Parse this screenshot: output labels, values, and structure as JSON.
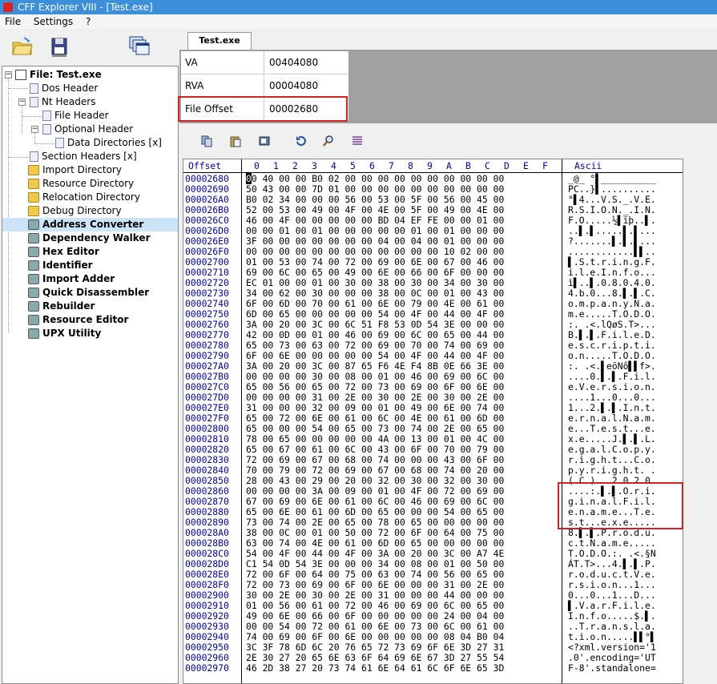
{
  "window": {
    "title": "CFF Explorer VIII - [Test.exe]"
  },
  "menu": {
    "items": [
      "File",
      "Settings",
      "?"
    ]
  },
  "tree": {
    "root": "File: Test.exe",
    "items": [
      {
        "label": "Dos Header"
      },
      {
        "label": "Nt Headers"
      },
      {
        "label": "File Header"
      },
      {
        "label": "Optional Header"
      },
      {
        "label": "Data Directories [x]"
      },
      {
        "label": "Section Headers [x]"
      },
      {
        "label": "Import Directory"
      },
      {
        "label": "Resource Directory"
      },
      {
        "label": "Relocation Directory"
      },
      {
        "label": "Debug Directory"
      },
      {
        "label": "Address Converter"
      },
      {
        "label": "Dependency Walker"
      },
      {
        "label": "Hex Editor"
      },
      {
        "label": "Identifier"
      },
      {
        "label": "Import Adder"
      },
      {
        "label": "Quick Disassembler"
      },
      {
        "label": "Rebuilder"
      },
      {
        "label": "Resource Editor"
      },
      {
        "label": "UPX Utility"
      }
    ],
    "selected": "Address Converter"
  },
  "tab": {
    "label": "Test.exe"
  },
  "converter": {
    "va_label": "VA",
    "va_value": "00404080",
    "rva_label": "RVA",
    "rva_value": "00004080",
    "fo_label": "File Offset",
    "fo_value": "00002680"
  },
  "hex": {
    "offset_header": "Offset",
    "columns": [
      "0",
      "1",
      "2",
      "3",
      "4",
      "5",
      "6",
      "7",
      "8",
      "9",
      "A",
      "B",
      "C",
      "D",
      "E",
      "F"
    ],
    "ascii_header": "Ascii",
    "rows": [
      {
        "off": "00002680",
        "bytes": "00 40 00 00 B0 02 00 00 00 00 00 00 00 00 00 00",
        "asc": "_@_ °▌__________"
      },
      {
        "off": "00002690",
        "bytes": "50 43 00 00 7D 01 00 00 00 00 00 00 00 00 00 00",
        "asc": "PC..}▌.........."
      },
      {
        "off": "000026A0",
        "bytes": "B0 02 34 00 00 00 56 00 53 00 5F 00 56 00 45 00",
        "asc": "°▌4...V.S._.V.E."
      },
      {
        "off": "000026B0",
        "bytes": "52 00 53 00 49 00 4F 00 4E 00 5F 00 49 00 4E 00",
        "asc": "R.S.I.O.N._.I.N."
      },
      {
        "off": "000026C0",
        "bytes": "46 00 4F 00 00 00 00 00 BD 04 EF FE 00 00 01 00",
        "asc": "F.O.....½▌ïþ..▌."
      },
      {
        "off": "000026D0",
        "bytes": "00 00 01 00 01 00 00 00 00 00 01 00 01 00 00 00",
        "asc": "..▌.▌.....▌.▌..."
      },
      {
        "off": "000026E0",
        "bytes": "3F 00 00 00 00 00 00 00 04 00 04 00 01 00 00 00",
        "asc": "?.......▌.▌.▌..."
      },
      {
        "off": "000026F0",
        "bytes": "00 00 00 00 00 00 00 00 00 00 00 00 10 02 00 00",
        "asc": "............▌▌.."
      },
      {
        "off": "00002700",
        "bytes": "01 00 53 00 74 00 72 00 69 00 6E 00 67 00 46 00",
        "asc": "▌.S.t.r.i.n.g.F."
      },
      {
        "off": "00002710",
        "bytes": "69 00 6C 00 65 00 49 00 6E 00 66 00 6F 00 00 00",
        "asc": "i.l.e.I.n.f.o..."
      },
      {
        "off": "00002720",
        "bytes": "EC 01 00 00 01 00 30 00 38 00 30 00 34 00 30 00",
        "asc": "ì▌..▌.0.8.0.4.0."
      },
      {
        "off": "00002730",
        "bytes": "34 00 62 00 30 00 00 00 38 00 0C 00 01 00 43 00",
        "asc": "4.b.0...8.▌.▌.C."
      },
      {
        "off": "00002740",
        "bytes": "6F 00 6D 00 70 00 61 00 6E 00 79 00 4E 00 61 00",
        "asc": "o.m.p.a.n.y.N.a."
      },
      {
        "off": "00002750",
        "bytes": "6D 00 65 00 00 00 00 00 54 00 4F 00 44 00 4F 00",
        "asc": "m.e.....T.O.D.O."
      },
      {
        "off": "00002760",
        "bytes": "3A 00 20 00 3C 00 6C 51 F8 53 0D 54 3E 00 00 00",
        "asc": ":. .<.lQøS.T>..."
      },
      {
        "off": "00002770",
        "bytes": "42 00 0D 00 01 00 46 00 69 00 6C 00 65 00 44 00",
        "asc": "B.▌.▌.F.i.l.e.D."
      },
      {
        "off": "00002780",
        "bytes": "65 00 73 00 63 00 72 00 69 00 70 00 74 00 69 00",
        "asc": "e.s.c.r.i.p.t.i."
      },
      {
        "off": "00002790",
        "bytes": "6F 00 6E 00 00 00 00 00 54 00 4F 00 44 00 4F 00",
        "asc": "o.n.....T.O.D.O."
      },
      {
        "off": "000027A0",
        "bytes": "3A 00 20 00 3C 00 87 65 F6 4E F4 8B 0E 66 3E 00",
        "asc": ":. .<.▌eöNô▌▌f>."
      },
      {
        "off": "000027B0",
        "bytes": "00 00 00 00 30 00 08 00 01 00 46 00 69 00 6C 00",
        "asc": "....0.▌.▌.F.i.l."
      },
      {
        "off": "000027C0",
        "bytes": "65 00 56 00 65 00 72 00 73 00 69 00 6F 00 6E 00",
        "asc": "e.V.e.r.s.i.o.n."
      },
      {
        "off": "000027D0",
        "bytes": "00 00 00 00 31 00 2E 00 30 00 2E 00 30 00 2E 00",
        "asc": "....1...0...0..."
      },
      {
        "off": "000027E0",
        "bytes": "31 00 00 00 32 00 09 00 01 00 49 00 6E 00 74 00",
        "asc": "1...2.▌.▌.I.n.t."
      },
      {
        "off": "000027F0",
        "bytes": "65 00 72 00 6E 00 61 00 6C 00 4E 00 61 00 6D 00",
        "asc": "e.r.n.a.l.N.a.m."
      },
      {
        "off": "00002800",
        "bytes": "65 00 00 00 54 00 65 00 73 00 74 00 2E 00 65 00",
        "asc": "e...T.e.s.t...e."
      },
      {
        "off": "00002810",
        "bytes": "78 00 65 00 00 00 00 00 4A 00 13 00 01 00 4C 00",
        "asc": "x.e.....J.▌.▌.L."
      },
      {
        "off": "00002820",
        "bytes": "65 00 67 00 61 00 6C 00 43 00 6F 00 70 00 79 00",
        "asc": "e.g.a.l.C.o.p.y."
      },
      {
        "off": "00002830",
        "bytes": "72 00 69 00 67 00 68 00 74 00 00 00 43 00 6F 00",
        "asc": "r.i.g.h.t...C.o."
      },
      {
        "off": "00002840",
        "bytes": "70 00 79 00 72 00 69 00 67 00 68 00 74 00 20 00",
        "asc": "p.y.r.i.g.h.t. ."
      },
      {
        "off": "00002850",
        "bytes": "28 00 43 00 29 00 20 00 32 00 30 00 32 00 30 00",
        "asc": "(.C.). .2.0.2.0."
      },
      {
        "off": "00002860",
        "bytes": "00 00 00 00 3A 00 09 00 01 00 4F 00 72 00 69 00",
        "asc": "....:.▌.▌.O.r.i."
      },
      {
        "off": "00002870",
        "bytes": "67 00 69 00 6E 00 61 00 6C 00 46 00 69 00 6C 00",
        "asc": "g.i.n.a.l.F.i.l."
      },
      {
        "off": "00002880",
        "bytes": "65 00 6E 00 61 00 6D 00 65 00 00 00 54 00 65 00",
        "asc": "e.n.a.m.e...T.e."
      },
      {
        "off": "00002890",
        "bytes": "73 00 74 00 2E 00 65 00 78 00 65 00 00 00 00 00",
        "asc": "s.t...e.x.e....."
      },
      {
        "off": "000028A0",
        "bytes": "38 00 0C 00 01 00 50 00 72 00 6F 00 64 00 75 00",
        "asc": "8.▌.▌.P.r.o.d.u."
      },
      {
        "off": "000028B0",
        "bytes": "63 00 74 00 4E 00 61 00 6D 00 65 00 00 00 00 00",
        "asc": "c.t.N.a.m.e....."
      },
      {
        "off": "000028C0",
        "bytes": "54 00 4F 00 44 00 4F 00 3A 00 20 00 3C 00 A7 4E",
        "asc": "T.O.D.O.:. .<.§N"
      },
      {
        "off": "000028D0",
        "bytes": "C1 54 0D 54 3E 00 00 00 34 00 08 00 01 00 50 00",
        "asc": "ÁT.T>...4.▌.▌.P."
      },
      {
        "off": "000028E0",
        "bytes": "72 00 6F 00 64 00 75 00 63 00 74 00 56 00 65 00",
        "asc": "r.o.d.u.c.t.V.e."
      },
      {
        "off": "000028F0",
        "bytes": "72 00 73 00 69 00 6F 00 6E 00 00 00 31 00 2E 00",
        "asc": "r.s.i.o.n...1..."
      },
      {
        "off": "00002900",
        "bytes": "30 00 2E 00 30 00 2E 00 31 00 00 00 44 00 00 00",
        "asc": "0...0...1...D..."
      },
      {
        "off": "00002910",
        "bytes": "01 00 56 00 61 00 72 00 46 00 69 00 6C 00 65 00",
        "asc": "▌.V.a.r.F.i.l.e."
      },
      {
        "off": "00002920",
        "bytes": "49 00 6E 00 66 00 6F 00 00 00 00 00 24 00 04 00",
        "asc": "I.n.f.o.....$.▌."
      },
      {
        "off": "00002930",
        "bytes": "00 00 54 00 72 00 61 00 6E 00 73 00 6C 00 61 00",
        "asc": "..T.r.a.n.s.l.a."
      },
      {
        "off": "00002940",
        "bytes": "74 00 69 00 6F 00 6E 00 00 00 00 00 08 04 B0 04",
        "asc": "t.i.o.n.....▌▌°▌"
      },
      {
        "off": "00002950",
        "bytes": "3C 3F 78 6D 6C 20 76 65 72 73 69 6F 6E 3D 27 31",
        "asc": "<?xml.version='1"
      },
      {
        "off": "00002960",
        "bytes": "2E 30 27 20 65 6E 63 6F 64 69 6E 67 3D 27 55 54",
        "asc": ".0'.encoding='UT"
      },
      {
        "off": "00002970",
        "bytes": "46 2D 38 27 20 73 74 61 6E 64 61 6C 6F 6E 65 3D",
        "asc": "F-8'.standalone="
      }
    ]
  },
  "icons": {
    "open": "folder-open-icon",
    "save": "save-icon",
    "windows": "windows-icon",
    "copy": "copy-icon",
    "paste": "paste-icon",
    "goto": "goto-icon",
    "undo": "refresh-icon",
    "search": "search-icon",
    "tool": "list-icon"
  }
}
